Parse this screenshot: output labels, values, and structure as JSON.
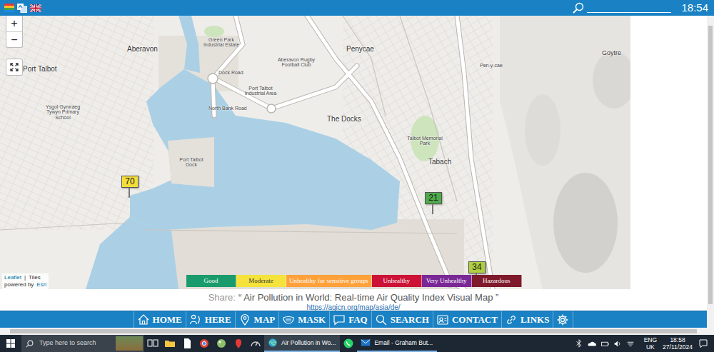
{
  "top_bar": {
    "time": "18:54"
  },
  "map": {
    "zoom": {
      "in": "+",
      "out": "−"
    },
    "labels": [
      "Aberavon",
      "Green Park Industrial Estate",
      "Penycae",
      "Aberavon Rugby Football Club",
      "Pen-y-cae",
      "Goytre",
      "Port Talbot",
      "Port Talbot Industrial Area",
      "Dock Road",
      "North Bank Road",
      "The Docks",
      "Talbot Memorial Park",
      "Tabach",
      "Port Talbot Dock",
      "Ysgol Gymraeg Tywyn Primary School"
    ],
    "pins": [
      {
        "value": "70",
        "color": "#f2dd3a"
      },
      {
        "value": "21",
        "color": "#4fab4a"
      },
      {
        "value": "34",
        "color": "#afcf3e"
      }
    ],
    "attribution": {
      "leaflet": "Leaflet",
      "separator": "|",
      "tiles": "Tiles",
      "powered_by": "powered by",
      "esri": "Esri"
    }
  },
  "legend": [
    {
      "label": "Good",
      "color": "#1a9b6c"
    },
    {
      "label": "Moderate",
      "color": "#f5e33c"
    },
    {
      "label": "Unhealthy for sensitive groups",
      "color": "#ffa13a"
    },
    {
      "label": "Unhealthy",
      "color": "#cc1236"
    },
    {
      "label": "Very Unhealthy",
      "color": "#7a2896"
    },
    {
      "label": "Hazardous",
      "color": "#7e1a2b"
    }
  ],
  "share": {
    "label": "Share:",
    "title": "“ Air Pollution in World: Real-time Air Quality Index Visual Map ”",
    "url": "https://aqicn.org/map/asia/de/"
  },
  "nav": [
    "HOME",
    "HERE",
    "MAP",
    "MASK",
    "FAQ",
    "SEARCH",
    "CONTACT",
    "LINKS"
  ],
  "taskbar": {
    "search_placeholder": "Type here to search",
    "apps": [
      {
        "label": "Air Pollution in Wo...",
        "selected": true
      },
      {
        "label": "Email - Graham But...",
        "selected": false
      }
    ],
    "language": [
      "ENG",
      "UK"
    ],
    "time": "18:58",
    "date": "27/11/2024"
  }
}
